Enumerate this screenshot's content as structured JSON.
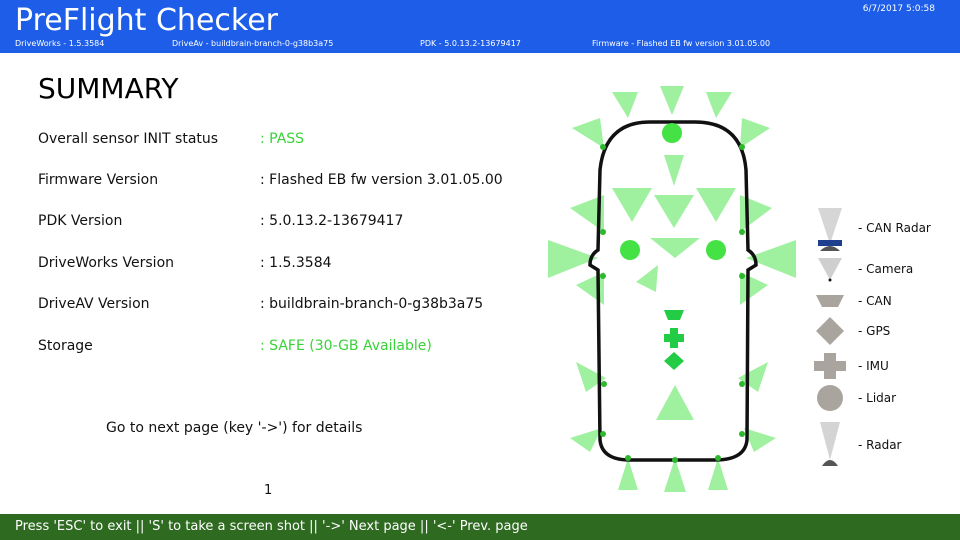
{
  "header": {
    "title": "PreFlight Checker",
    "datetime": "6/7/2017  5:0:58",
    "driveworks": "DriveWorks - 1.5.3584",
    "driveav": "DriveAv - buildbrain-branch-0-g38b3a75",
    "pdk": "PDK - 5.0.13.2-13679417",
    "firmware": "Firmware - Flashed EB fw version 3.01.05.00"
  },
  "summary": {
    "title": "SUMMARY",
    "rows": [
      {
        "label": "Overall sensor INIT status",
        "value": ": PASS",
        "status": "ok"
      },
      {
        "label": "Firmware Version",
        "value": ": Flashed EB fw version 3.01.05.00",
        "status": "normal"
      },
      {
        "label": "PDK Version",
        "value": ": 5.0.13.2-13679417",
        "status": "normal"
      },
      {
        "label": "DriveWorks Version",
        "value": ": 1.5.3584",
        "status": "normal"
      },
      {
        "label": "DriveAV Version",
        "value": ": buildbrain-branch-0-g38b3a75",
        "status": "normal"
      },
      {
        "label": "Storage",
        "value": ": SAFE (30-GB Available)",
        "status": "ok"
      }
    ],
    "hint": "Go to next page (key '->') for details",
    "page_number": "1"
  },
  "legend": [
    {
      "label": "- CAN Radar",
      "icon": "can-radar-icon"
    },
    {
      "label": "- Camera",
      "icon": "camera-icon"
    },
    {
      "label": "- CAN",
      "icon": "can-icon"
    },
    {
      "label": "- GPS",
      "icon": "gps-icon"
    },
    {
      "label": "- IMU",
      "icon": "imu-icon"
    },
    {
      "label": "- Lidar",
      "icon": "lidar-icon"
    },
    {
      "label": "- Radar",
      "icon": "radar-icon"
    }
  ],
  "footer": {
    "text": "Press 'ESC' to exit ||  'S' to take a screen shot  || '->' Next page || '<-' Prev. page"
  },
  "colors": {
    "header_bg": "#1d5de8",
    "footer_bg": "#2e6b21",
    "status_ok": "#39d239",
    "sensor_ok": "#33dd33",
    "legend_gray": "#a9a49d"
  }
}
